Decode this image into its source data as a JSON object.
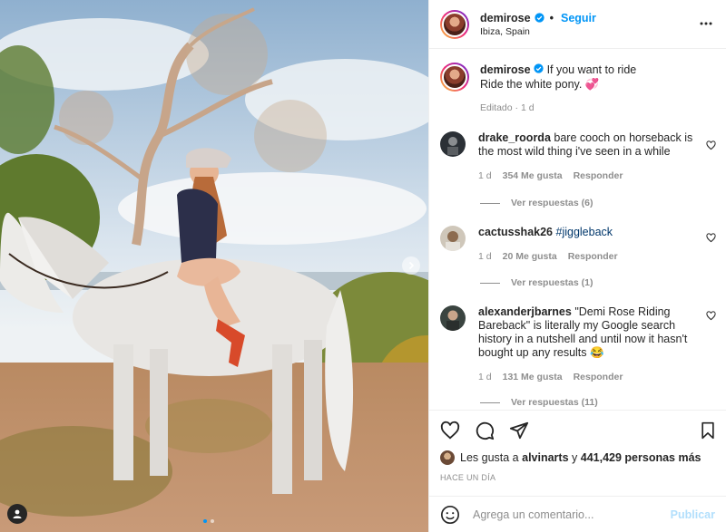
{
  "post": {
    "username": "demirose",
    "follow_label": "Seguir",
    "location": "Ibiza, Spain",
    "caption_line1": "If you want to ride",
    "caption_line2": "Ride the white pony. 💞",
    "caption_meta": "Editado · 1 d"
  },
  "comments": [
    {
      "username": "drake_roorda",
      "text": "bare cooch on horseback is the most wild thing i've seen in a while",
      "time": "1 d",
      "likes": "354 Me gusta",
      "reply_label": "Responder",
      "view_replies": "Ver respuestas (6)"
    },
    {
      "username": "cactusshak26",
      "text": "#jiggleback",
      "time": "1 d",
      "likes": "20 Me gusta",
      "reply_label": "Responder",
      "view_replies": "Ver respuestas (1)"
    },
    {
      "username": "alexanderjbarnes",
      "text": "\"Demi Rose Riding Bareback\" is literally my Google search history in a nutshell and until now it hasn't bought up any results 😂",
      "time": "1 d",
      "likes": "131 Me gusta",
      "reply_label": "Responder",
      "view_replies": "Ver respuestas (11)"
    }
  ],
  "likes_bar": {
    "prefix": "Les gusta a",
    "first_user": "alvinarts",
    "middle": "y",
    "count": "441,429 personas más"
  },
  "time_ago": "HACE UN DÍA",
  "composer": {
    "placeholder": "Agrega un comentario...",
    "publish_label": "Publicar"
  },
  "colors": {
    "accent": "#0095f6",
    "publish_disabled": "#b2dffc",
    "meta_gray": "#8e8e8e",
    "hashtag": "#00376b"
  },
  "carousel": {
    "total": 2,
    "active": 1
  }
}
